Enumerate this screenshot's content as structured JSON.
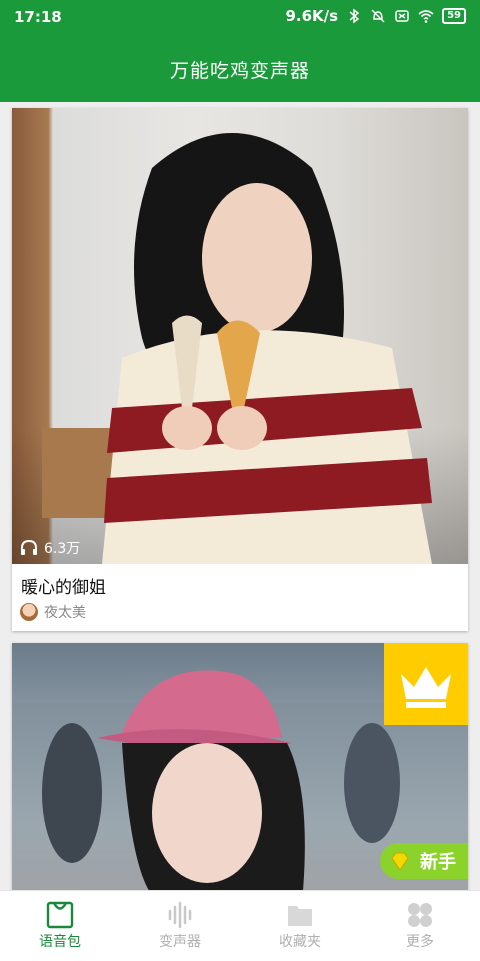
{
  "status_bar": {
    "time": "17:18",
    "net_speed": "9.6K/s",
    "battery": "59"
  },
  "app_bar": {
    "title": "万能吃鸡变声器"
  },
  "cards": [
    {
      "plays": "6.3万",
      "title": "暖心的御姐",
      "author": "夜太美"
    },
    {
      "badge_new": "新手"
    }
  ],
  "bottom_nav": {
    "items": [
      {
        "label": "语音包",
        "icon": "bag-icon",
        "active": true
      },
      {
        "label": "变声器",
        "icon": "waveform-icon",
        "active": false
      },
      {
        "label": "收藏夹",
        "icon": "folder-icon",
        "active": false
      },
      {
        "label": "更多",
        "icon": "grid-icon",
        "active": false
      }
    ]
  },
  "colors": {
    "primary": "#1a9a3a",
    "badge_yellow": "#ffcc00",
    "badge_green": "#8bd22b"
  }
}
